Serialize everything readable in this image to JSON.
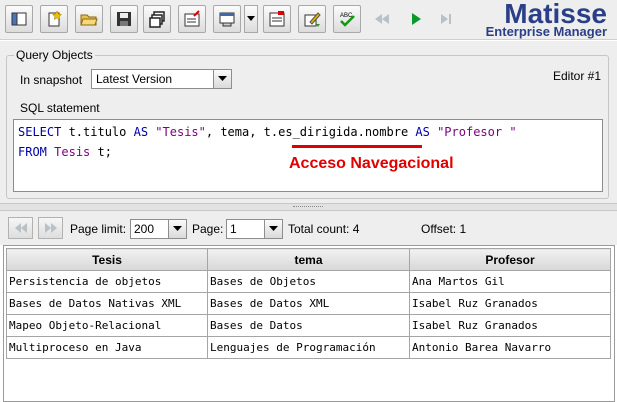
{
  "brand": {
    "name": "Matisse",
    "subtitle": "Enterprise Manager"
  },
  "toolbar": {
    "buttons": [
      "panel-icon",
      "new-icon",
      "open-folder-icon",
      "save-icon",
      "copy-windows-icon",
      "note-edit-icon",
      "print-dialog-icon",
      "edit-form-icon",
      "pen-edit-icon",
      "spell-check-icon",
      "rewind-icon",
      "play-icon",
      "next-icon"
    ]
  },
  "query": {
    "legend": "Query Objects",
    "snapshot_label": "In snapshot",
    "snapshot_value": "Latest Version",
    "editor_label": "Editor #1",
    "sql_label": "SQL statement",
    "sql": {
      "line1": [
        {
          "t": "SELECT",
          "c": "kw"
        },
        {
          "t": " t.titulo ",
          "c": "id"
        },
        {
          "t": "AS",
          "c": "kw"
        },
        {
          "t": " ",
          "c": "id"
        },
        {
          "t": "\"Tesis\"",
          "c": "str"
        },
        {
          "t": ", tema, t.es_dirigida.nombre ",
          "c": "id"
        },
        {
          "t": "AS",
          "c": "kw"
        },
        {
          "t": " ",
          "c": "id"
        },
        {
          "t": "\"Profesor \"",
          "c": "str"
        }
      ],
      "line2": [
        {
          "t": "FROM",
          "c": "kw"
        },
        {
          "t": " ",
          "c": "id"
        },
        {
          "t": "Tesis",
          "c": "str"
        },
        {
          "t": " t;",
          "c": "id"
        }
      ]
    },
    "annotation": "Acceso Navegacional",
    "annotation_color": "#e00000"
  },
  "pager": {
    "page_limit_label": "Page limit:",
    "page_limit_value": "200",
    "page_label": "Page:",
    "page_value": "1",
    "total_count": "Total count: 4",
    "offset": "Offset: 1"
  },
  "results": {
    "columns": [
      "Tesis",
      "tema",
      "Profesor"
    ],
    "rows": [
      [
        "Persistencia de objetos",
        "Bases de Objetos",
        "Ana Martos Gil"
      ],
      [
        "Bases de Datos Nativas XML",
        "Bases de Datos XML",
        "Isabel Ruz Granados"
      ],
      [
        "Mapeo Objeto-Relacional",
        "Bases de Datos",
        "Isabel Ruz Granados"
      ],
      [
        "Multiproceso en Java",
        "Lenguajes de Programación",
        "Antonio Barea Navarro"
      ]
    ]
  },
  "colors": {
    "brand": "#2a3f87",
    "keyword": "#0000aa",
    "string": "#800080"
  }
}
